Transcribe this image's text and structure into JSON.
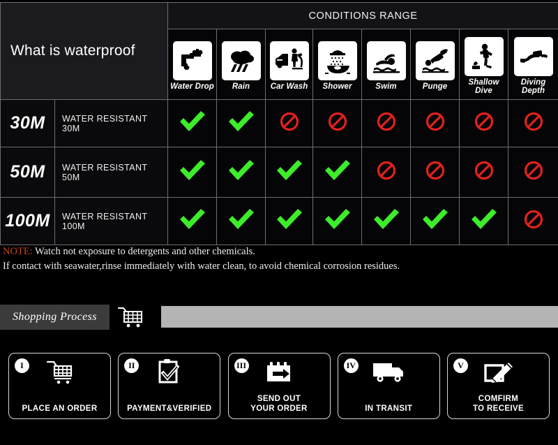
{
  "table": {
    "title": "What is waterproof",
    "conditions_range_label": "CONDITIONS RANGE",
    "columns": [
      {
        "label": "Water Drop",
        "icon": "faucet-water-drop-icon"
      },
      {
        "label": "Rain",
        "icon": "rain-cloud-icon"
      },
      {
        "label": "Car Wash",
        "icon": "car-wash-icon"
      },
      {
        "label": "Shower",
        "icon": "shower-icon"
      },
      {
        "label": "Swim",
        "icon": "swimmer-icon"
      },
      {
        "label": "Punge",
        "icon": "plunge-dive-icon"
      },
      {
        "label": "Shallow\nDive",
        "icon": "shallow-dive-icon"
      },
      {
        "label": "Diving\nDepth",
        "icon": "scuba-diver-icon"
      }
    ],
    "rows": [
      {
        "depth": "30M",
        "description": "WATER RESISTANT  30M",
        "marks": [
          "check",
          "check",
          "ban",
          "ban",
          "ban",
          "ban",
          "ban",
          "ban"
        ]
      },
      {
        "depth": "50M",
        "description": "WATER RESISTANT 50M",
        "marks": [
          "check",
          "check",
          "check",
          "check",
          "ban",
          "ban",
          "ban",
          "ban"
        ]
      },
      {
        "depth": "100M",
        "description": "WATER RESISTANT  100M",
        "marks": [
          "check",
          "check",
          "check",
          "check",
          "check",
          "check",
          "check",
          "ban"
        ]
      }
    ]
  },
  "note": {
    "keyword": "NOTE:",
    "line1": " Watch not exposure to detergents and other chemicals.",
    "line2": "If contact with seawater,rinse immediately with water clean, to avoid chemical corrosion residues."
  },
  "shopping_process": {
    "tag_label": "Shopping Process",
    "cart_icon": "shopping-cart-icon"
  },
  "steps": [
    {
      "numeral": "I",
      "label": "PLACE AN ORDER",
      "icon": "shopping-cart-icon"
    },
    {
      "numeral": "II",
      "label": "PAYMENT&VERIFIED",
      "icon": "clipboard-check-icon"
    },
    {
      "numeral": "III",
      "label": "SEND OUT\nYOUR ORDER",
      "icon": "package-arrow-icon"
    },
    {
      "numeral": "IV",
      "label": "IN TRANSIT",
      "icon": "delivery-truck-icon"
    },
    {
      "numeral": "V",
      "label": "COMFIRM\nTO RECEIVE",
      "icon": "sign-document-icon"
    }
  ],
  "colors": {
    "check_green": "#3dec2a",
    "ban_red": "#e2211c",
    "note_keyword": "#c4441f",
    "tag_bg": "#3b3b3b",
    "bar_gray": "#b4b4b4",
    "title_cell_bg": "#1b1b1f"
  }
}
